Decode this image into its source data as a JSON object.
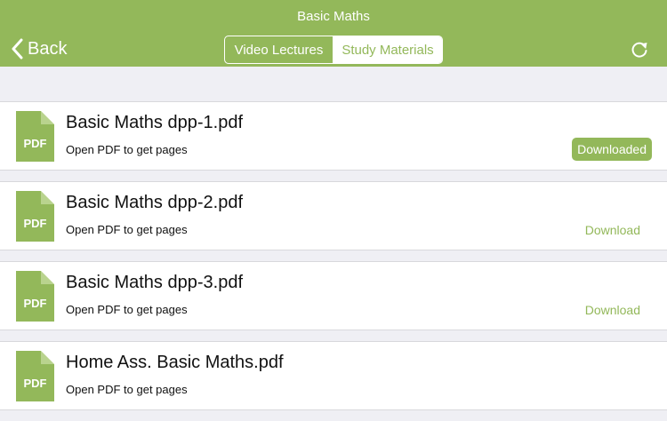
{
  "nav": {
    "title": "Basic Maths",
    "back_label": "Back",
    "refresh_icon": "refresh-icon"
  },
  "tabs": [
    {
      "label": "Video Lectures",
      "selected": false
    },
    {
      "label": "Study Materials",
      "selected": true
    }
  ],
  "files": [
    {
      "name": "Basic Maths dpp-1.pdf",
      "subtitle": "Open PDF to get pages",
      "icon_label": "PDF",
      "status": "Downloaded"
    },
    {
      "name": "Basic Maths dpp-2.pdf",
      "subtitle": "Open PDF to get pages",
      "icon_label": "PDF",
      "status": "Download"
    },
    {
      "name": "Basic Maths dpp-3.pdf",
      "subtitle": "Open PDF to get pages",
      "icon_label": "PDF",
      "status": "Download"
    },
    {
      "name": "Home Ass. Basic Maths.pdf",
      "subtitle": "Open PDF to get pages",
      "icon_label": "PDF",
      "status": ""
    }
  ],
  "colors": {
    "accent": "#93b85a",
    "background": "#efeff4",
    "row_background": "#ffffff"
  }
}
